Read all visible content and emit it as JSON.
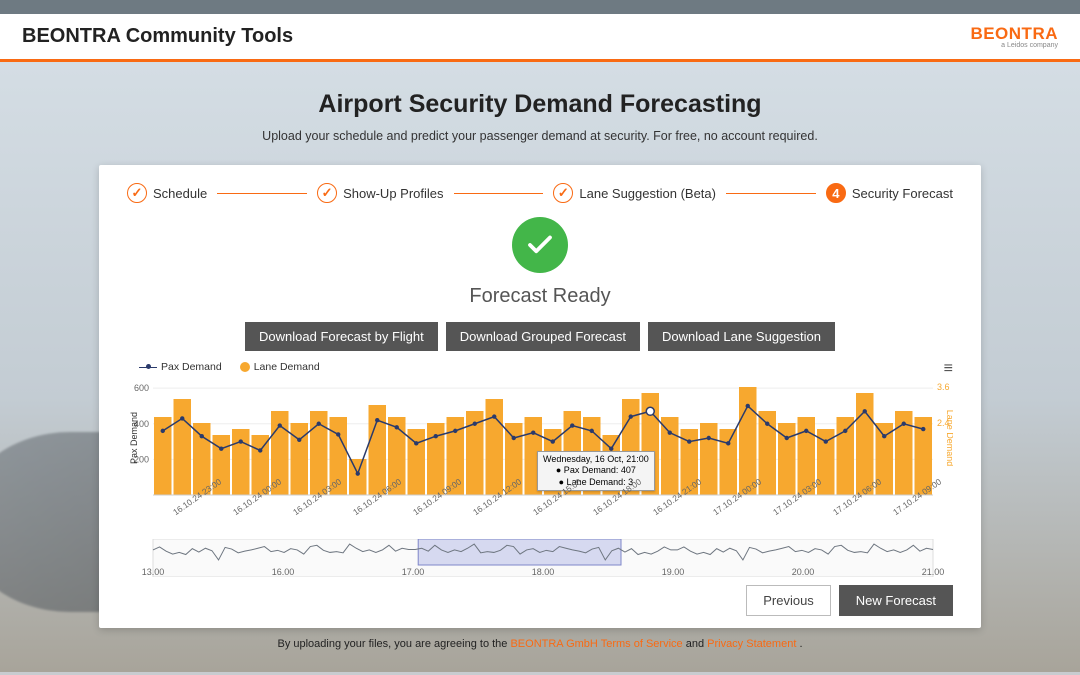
{
  "header": {
    "title": "BEONTRA Community Tools",
    "brand": "BEONTRA",
    "brand_sub": "a Leidos company"
  },
  "hero": {
    "title": "Airport Security Demand Forecasting",
    "subtitle": "Upload your schedule and predict your passenger demand at security. For free, no account required."
  },
  "stepper": {
    "steps": [
      {
        "label": "Schedule",
        "state": "done"
      },
      {
        "label": "Show-Up Profiles",
        "state": "done"
      },
      {
        "label": "Lane Suggestion (Beta)",
        "state": "done"
      },
      {
        "label": "Security Forecast",
        "state": "active",
        "num": "4"
      }
    ]
  },
  "ready": {
    "heading": "Forecast Ready",
    "buttons": {
      "by_flight": "Download Forecast by Flight",
      "grouped": "Download Grouped Forecast",
      "lane": "Download Lane Suggestion"
    }
  },
  "footer_buttons": {
    "previous": "Previous",
    "new_forecast": "New Forecast"
  },
  "disclaimer": {
    "prefix": "By uploading your files, you are agreeing to the ",
    "tos": "BEONTRA GmbH Terms of Service",
    "mid": " and ",
    "privacy": "Privacy Statement",
    "suffix": "."
  },
  "chart_data": {
    "type": "combo",
    "title": "",
    "legend": [
      "Pax Demand",
      "Lane Demand"
    ],
    "left_axis": {
      "label": "Pax Demand",
      "ticks": [
        200,
        400,
        600
      ],
      "range": [
        0,
        640
      ]
    },
    "right_axis": {
      "label": "Lane Demand",
      "ticks": [
        2.4,
        3.6
      ],
      "range": [
        0,
        3.8
      ]
    },
    "tooltip": {
      "header": "Wednesday, 16 Oct, 21:00",
      "line1": "● Pax Demand: 407",
      "line2": "● Lane Demand: 3"
    },
    "x_labels_shown": [
      "16.10.24 23:00",
      "16.10.24 00:00",
      "16.10.24 03:00",
      "16.10.24 06:00",
      "16.10.24 09:00",
      "16.10.24 12:00",
      "16.10.24 15:00",
      "16.10.24 18:00",
      "16.10.24 21:00",
      "17.10.24 00:00",
      "17.10.24 03:00",
      "17.10.24 06:00",
      "17.10.24 09:00"
    ],
    "navigator": {
      "labels": [
        "13.00",
        "16.00",
        "17.00",
        "18.00",
        "19.00",
        "20.00",
        "21.00"
      ]
    },
    "series": [
      {
        "name": "Lane Demand",
        "type": "bar",
        "color": "#f7a82f",
        "values": [
          2.6,
          3.2,
          2.4,
          2.0,
          2.2,
          2.0,
          2.8,
          2.4,
          2.8,
          2.6,
          1.2,
          3.0,
          2.6,
          2.2,
          2.4,
          2.6,
          2.8,
          3.2,
          2.4,
          2.6,
          2.2,
          2.8,
          2.6,
          2.0,
          3.2,
          3.4,
          2.6,
          2.2,
          2.4,
          2.2,
          3.6,
          2.8,
          2.4,
          2.6,
          2.2,
          2.6,
          3.4,
          2.4,
          2.8,
          2.6
        ]
      },
      {
        "name": "Pax Demand",
        "type": "line",
        "color": "#2a3a6b",
        "values": [
          360,
          430,
          330,
          260,
          300,
          250,
          390,
          310,
          400,
          340,
          120,
          420,
          380,
          290,
          330,
          360,
          400,
          440,
          320,
          350,
          300,
          390,
          360,
          260,
          440,
          470,
          350,
          300,
          320,
          290,
          500,
          400,
          320,
          360,
          300,
          360,
          470,
          330,
          400,
          370
        ]
      }
    ]
  }
}
